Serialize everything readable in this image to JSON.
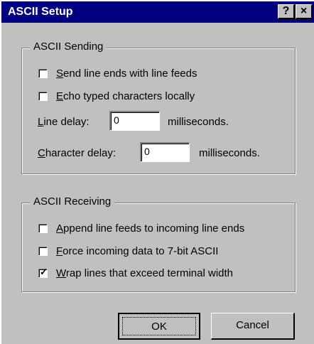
{
  "window": {
    "title": "ASCII Setup",
    "help_glyph": "?",
    "close_glyph": "×"
  },
  "sending": {
    "legend": "ASCII Sending",
    "send_line_ends": {
      "mnemonic": "S",
      "rest": "end line ends with line feeds",
      "checked": false
    },
    "echo_typed": {
      "mnemonic": "E",
      "rest": "cho typed characters locally",
      "checked": false
    },
    "line_delay": {
      "mnemonic": "L",
      "rest": "ine delay:",
      "value": "0",
      "unit": "milliseconds."
    },
    "char_delay": {
      "mnemonic": "C",
      "rest": "haracter delay:",
      "value": "0",
      "unit": "milliseconds."
    }
  },
  "receiving": {
    "legend": "ASCII Receiving",
    "append_feeds": {
      "mnemonic": "A",
      "rest": "ppend line feeds to incoming line ends",
      "checked": false
    },
    "force_7bit": {
      "mnemonic": "F",
      "rest": "orce incoming data to 7-bit ASCII",
      "checked": false
    },
    "wrap_lines": {
      "mnemonic": "W",
      "rest": "rap lines that exceed terminal width",
      "checked": true
    }
  },
  "buttons": {
    "ok": "OK",
    "cancel": "Cancel"
  },
  "check_glyph": "✓"
}
